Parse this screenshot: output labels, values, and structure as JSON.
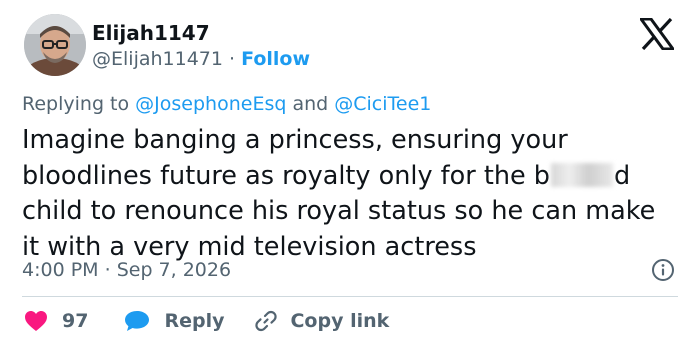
{
  "author": {
    "display_name": "Elijah1147",
    "handle": "@Elijah11471",
    "separator": "·",
    "follow_label": "Follow"
  },
  "reply_context": {
    "prefix": "Replying to",
    "mention_1": "@JosephoneEsq",
    "conjunction": "and",
    "mention_2": "@CiciTee1"
  },
  "tweet": {
    "line_1": "Imagine banging a princess, ensuring your",
    "line_2_before": "bloodlines future as royalty only for the b",
    "line_2_after": "d",
    "line_3": "child to renounce his royal status so he can make",
    "line_4": "it with a very mid television actress"
  },
  "meta": {
    "time": "4:00 PM",
    "separator": "·",
    "date": "Sep 7, 2026"
  },
  "actions": {
    "like_count": "97",
    "reply_label": "Reply",
    "copy_link_label": "Copy link"
  },
  "colors": {
    "accent": "#1d9bf0",
    "like": "#f91880",
    "text": "#0f1419",
    "muted": "#536471"
  },
  "icons": [
    "x-logo-icon",
    "info-icon",
    "heart-icon",
    "reply-bubble-icon",
    "link-icon"
  ]
}
